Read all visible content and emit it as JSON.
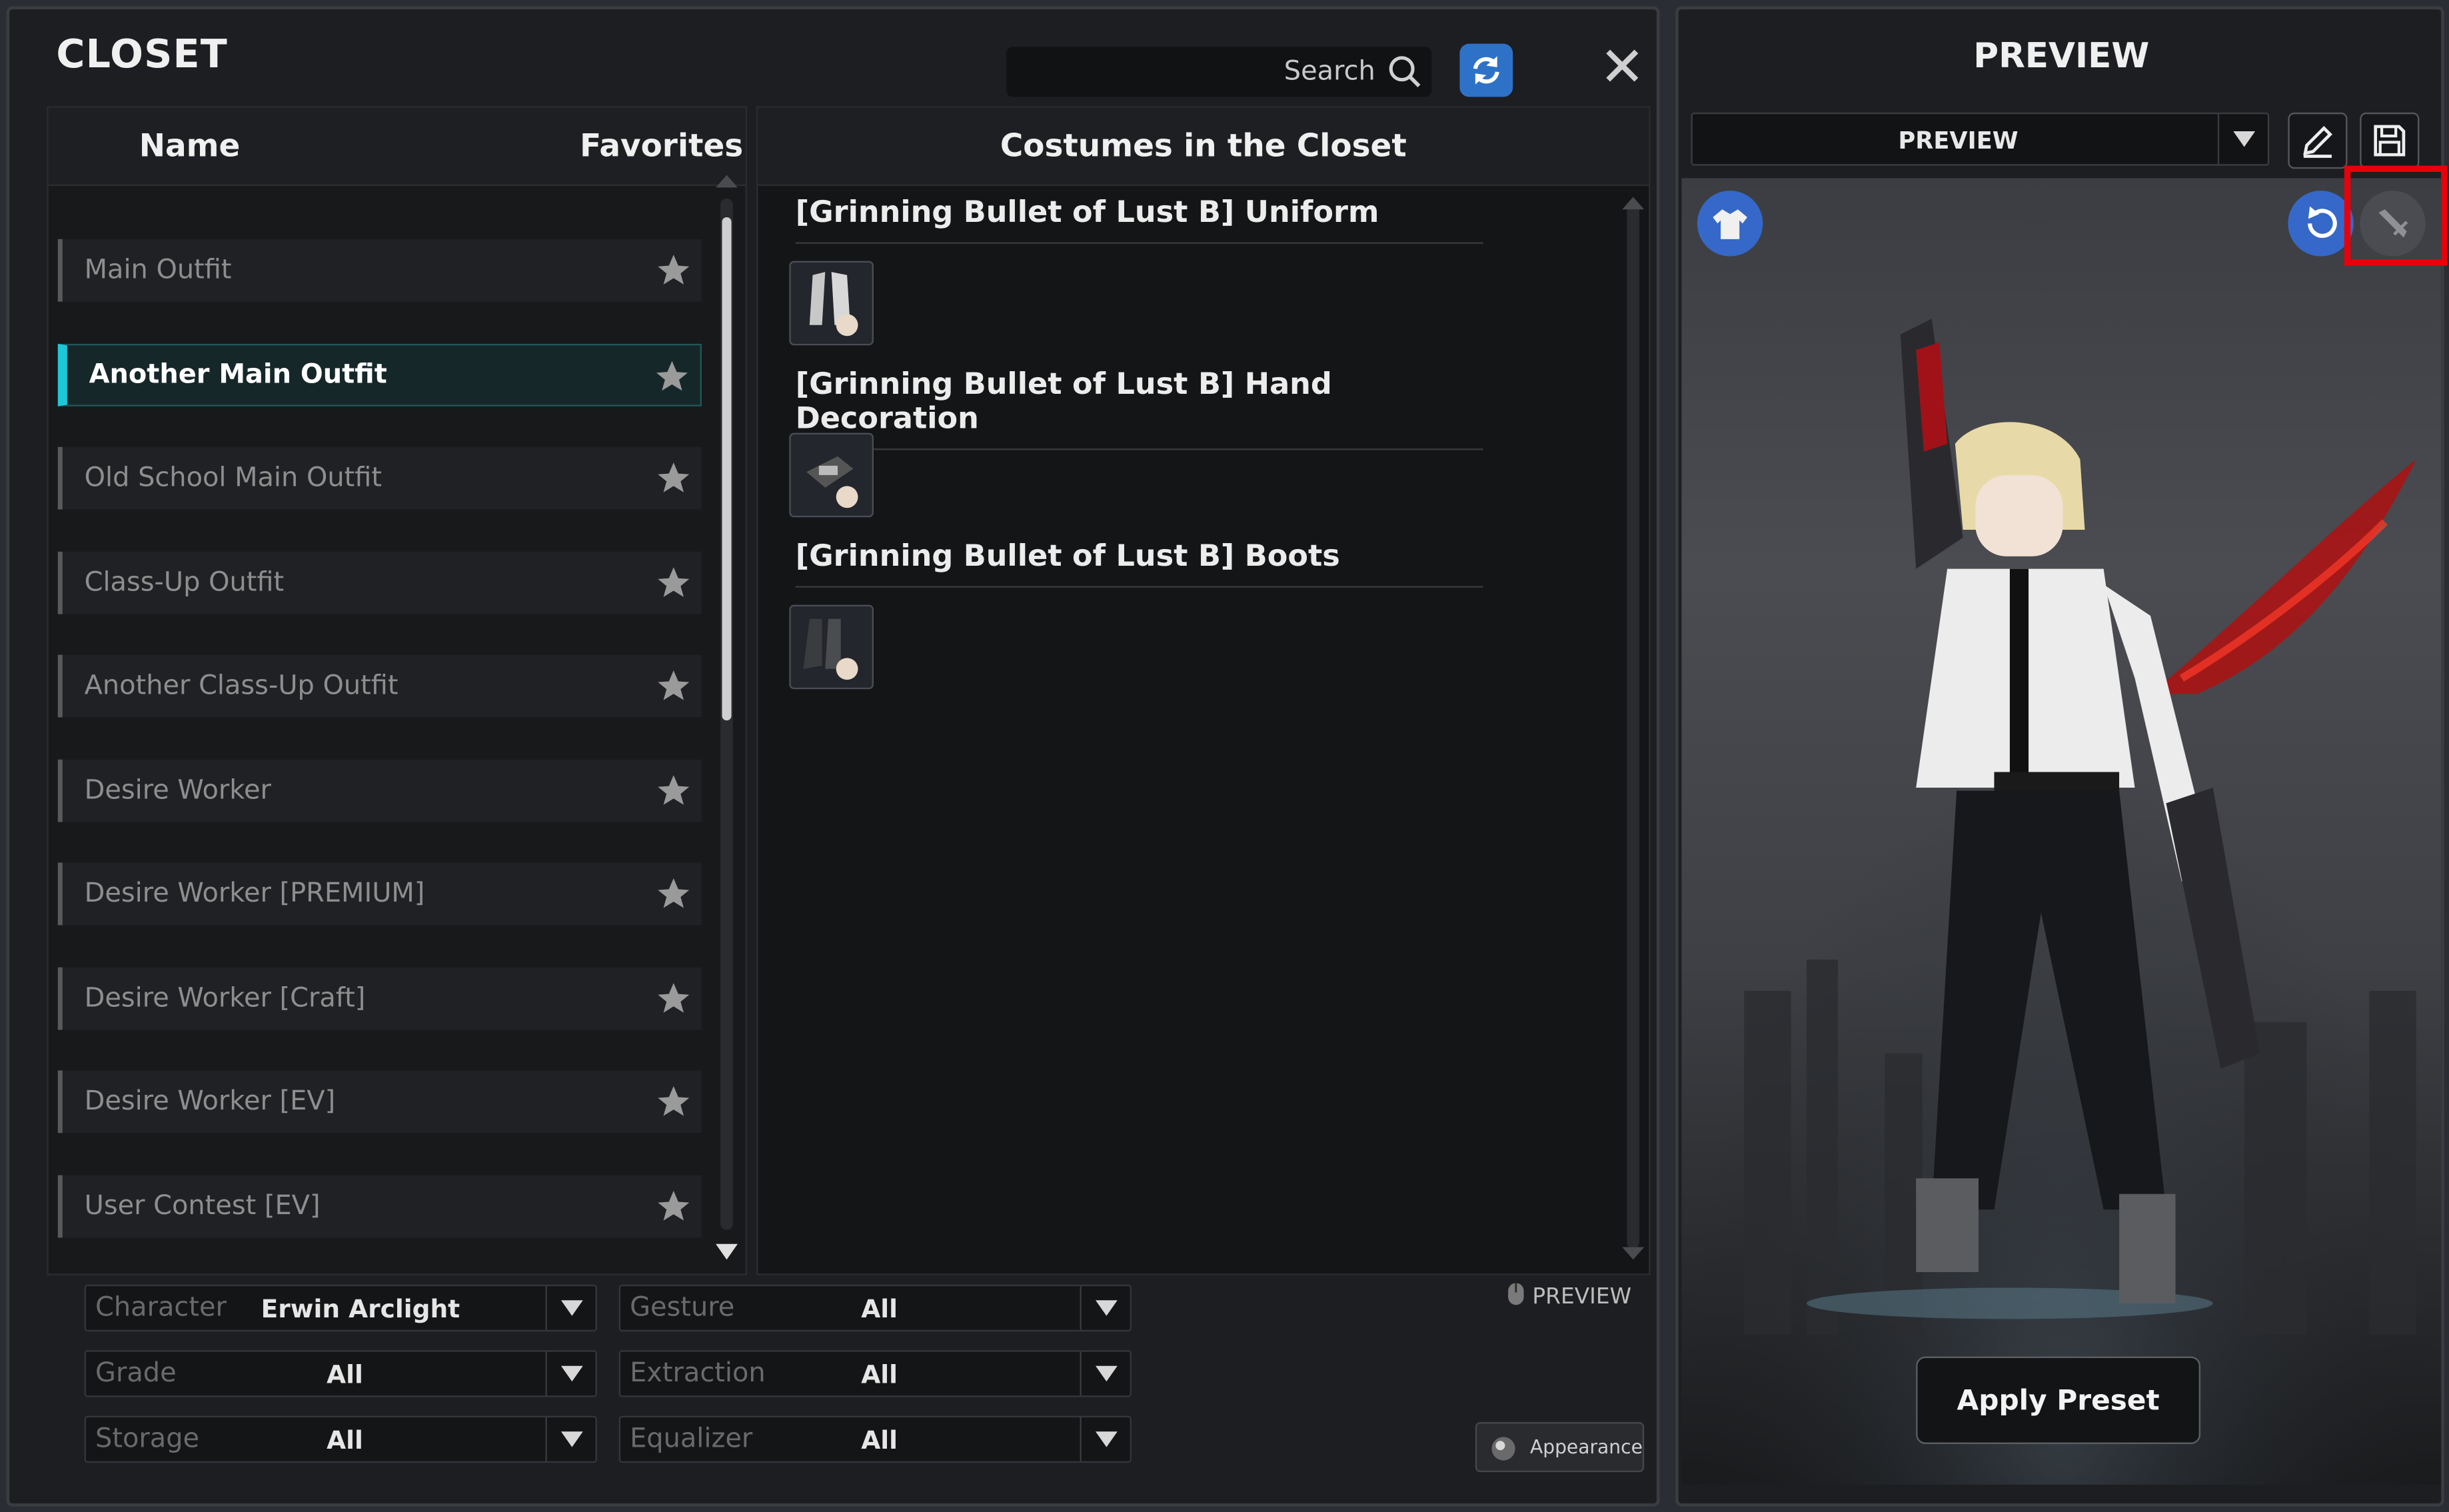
{
  "closet": {
    "title": "CLOSET",
    "search_label": "Search",
    "columns": {
      "name": "Name",
      "favorites": "Favorites"
    },
    "outfits": [
      {
        "label": "Main Outfit",
        "selected": false
      },
      {
        "label": "Another Main Outfit",
        "selected": true
      },
      {
        "label": "Old School Main Outfit",
        "selected": false
      },
      {
        "label": "Class-Up Outfit",
        "selected": false
      },
      {
        "label": "Another Class-Up Outfit",
        "selected": false
      },
      {
        "label": "Desire Worker",
        "selected": false
      },
      {
        "label": "Desire Worker [PREMIUM]",
        "selected": false
      },
      {
        "label": "Desire Worker [Craft]",
        "selected": false
      },
      {
        "label": "Desire Worker [EV]",
        "selected": false
      },
      {
        "label": "User Contest [EV]",
        "selected": false
      }
    ]
  },
  "costumes": {
    "header": "Costumes in the Closet",
    "items": [
      {
        "title": "[Grinning Bullet of Lust B] Uniform",
        "icon": "uniform-icon"
      },
      {
        "title": "[Grinning Bullet of Lust B] Hand Decoration",
        "icon": "hand-decoration-icon"
      },
      {
        "title": "[Grinning Bullet of Lust B] Boots",
        "icon": "boots-icon"
      }
    ]
  },
  "filters": {
    "character": {
      "label": "Character",
      "value": "Erwin Arclight"
    },
    "gesture": {
      "label": "Gesture",
      "value": "All"
    },
    "grade": {
      "label": "Grade",
      "value": "All"
    },
    "extraction": {
      "label": "Extraction",
      "value": "All"
    },
    "storage": {
      "label": "Storage",
      "value": "All"
    },
    "equalizer": {
      "label": "Equalizer",
      "value": "All"
    }
  },
  "preview_toggle": "PREVIEW",
  "appearance_button": "Appearance",
  "preview": {
    "title": "PREVIEW",
    "preset_value": "PREVIEW",
    "apply_label": "Apply Preset"
  },
  "colors": {
    "accent": "#1cc8d8",
    "refresh": "#2e72c8",
    "highlight": "#e8000a"
  }
}
